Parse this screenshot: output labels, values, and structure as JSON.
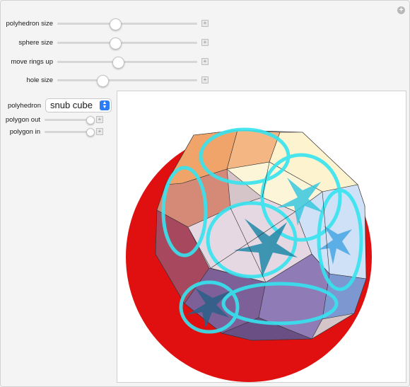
{
  "controls": {
    "sliders": [
      {
        "label": "polyhedron size",
        "value_fraction": 0.41
      },
      {
        "label": "sphere size",
        "value_fraction": 0.41
      },
      {
        "label": "move rings up",
        "value_fraction": 0.43
      },
      {
        "label": "hole size",
        "value_fraction": 0.32
      }
    ],
    "polyhedron_label": "polyhedron",
    "polyhedron_value": "snub cube",
    "small_sliders": [
      {
        "label": "polygon out",
        "value_fraction": 0.95
      },
      {
        "label": "polygon in",
        "value_fraction": 0.95
      }
    ]
  },
  "icons": {
    "corner": "plus-circle-icon",
    "expand": "plus-square-icon",
    "select_arrows": "updown-chevron-icon"
  },
  "colors": {
    "accent": "#2b7cf6",
    "ring_cyan": "#35e4f0",
    "sphere_red": "#e01010"
  }
}
